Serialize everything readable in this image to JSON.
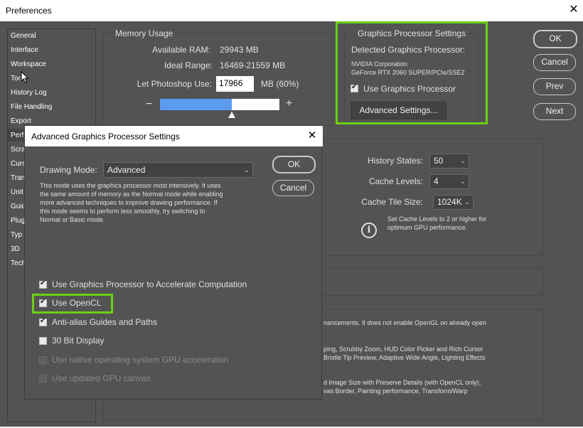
{
  "window": {
    "title": "Preferences",
    "close_glyph": "✕"
  },
  "sidebar": {
    "items": [
      "General",
      "Interface",
      "Workspace",
      "Tools",
      "History Log",
      "File Handling",
      "Export",
      "Performance",
      "Scratch Disks",
      "Cursors",
      "Transparency & Gamut",
      "Units & Rulers",
      "Guides, Grid & Slices",
      "Plug-ins",
      "Type",
      "3D",
      "Technology Previews"
    ],
    "visible_text": [
      "General",
      "Interface",
      "Workspace",
      "Too",
      "History Log",
      "File Handling",
      "Export",
      "Perf",
      "Scra",
      "Curs",
      "Tran",
      "Unit",
      "Guid",
      "Plug",
      "Typ",
      "3D",
      "Tech"
    ],
    "selected_index": 7
  },
  "memory": {
    "legend": "Memory Usage",
    "available_label": "Available RAM:",
    "available_value": "29943 MB",
    "ideal_label": "Ideal Range:",
    "ideal_value": "16469-21559 MB",
    "let_label": "Let Photoshop Use:",
    "let_value": "17966",
    "let_unit": "MB (60%)",
    "minus": "−",
    "plus": "+",
    "slider_fraction": 0.6
  },
  "gpu": {
    "legend": "Graphics Processor Settings",
    "detected_label": "Detected Graphics Processor:",
    "vendor": "NVIDIA Corporation",
    "model": "GeForce RTX 2060 SUPER/PCIe/SSE2",
    "use_gpu_label": "Use Graphics Processor",
    "use_gpu_checked": true,
    "advanced_button": "Advanced Settings..."
  },
  "side_buttons": {
    "ok": "OK",
    "cancel": "Cancel",
    "prev": "Prev",
    "next": "Next"
  },
  "history_cache": {
    "history_label": "History States:",
    "history_value": "50",
    "cache_levels_label": "Cache Levels:",
    "cache_levels_value": "4",
    "tile_label": "Cache Tile Size:",
    "tile_value": "1024K",
    "info_line1": "Set Cache Levels to 2 or higher for",
    "info_line2": "optimum GPU performance.",
    "info_glyph": "i"
  },
  "description": {
    "line1": "nancements. It does not enable OpenGL on already open",
    "line2": "ping, Scrubby Zoom, HUD Color Picker and Rich Cursor",
    "line3": "Bristle Tip Preview, Adaptive Wide Angle, Lighting Effects",
    "line4": "d Image Size with Preserve Details (with OpenCL only),",
    "line5": "vas Border, Painting performance, Transform/Warp"
  },
  "advanced_dialog": {
    "title": "Advanced Graphics Processor Settings",
    "close_glyph": "✕",
    "drawing_mode_label": "Drawing Mode:",
    "drawing_mode_value": "Advanced",
    "desc_line1": "This mode uses the graphics processor most intensively.  It uses",
    "desc_line2": "the same amount of memory as the Normal mode while enabling",
    "desc_line3": "more advanced techniques to improve drawing performance.  If",
    "desc_line4": "this mode seems to perform less smoothly, try switching to",
    "desc_line5": "Normal or Basic mode.",
    "ok": "OK",
    "cancel": "Cancel",
    "options": [
      {
        "label": "Use Graphics Processor to Accelerate Computation",
        "checked": true,
        "disabled": false
      },
      {
        "label": "Use OpenCL",
        "checked": true,
        "disabled": false
      },
      {
        "label": "Anti-alias Guides and Paths",
        "checked": true,
        "disabled": false
      },
      {
        "label": "30 Bit Display",
        "checked": false,
        "disabled": false
      },
      {
        "label": "Use native operating system GPU acceleration",
        "checked": false,
        "disabled": true
      },
      {
        "label": "Use updated GPU canvas",
        "checked": false,
        "disabled": true
      }
    ]
  },
  "colors": {
    "highlight": "#6cd016",
    "panel": "#535353",
    "slider_fill": "#5b9cf0"
  }
}
